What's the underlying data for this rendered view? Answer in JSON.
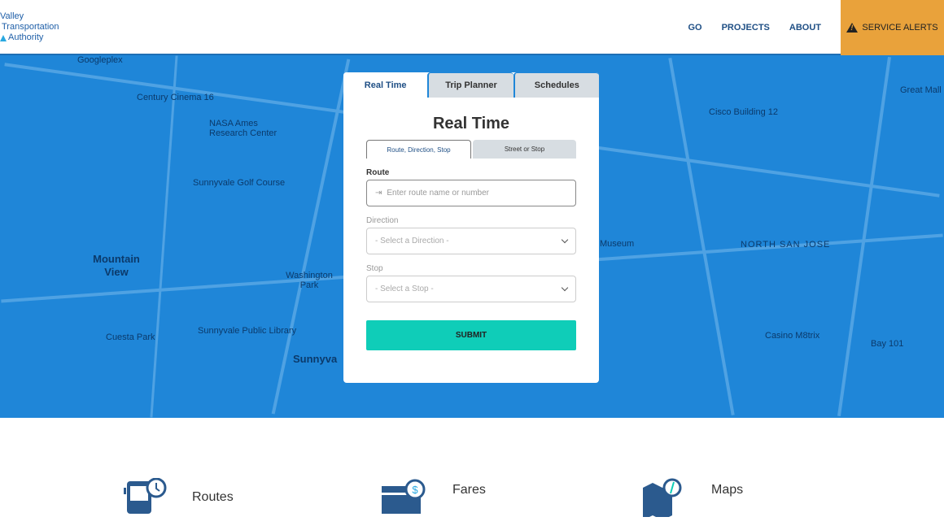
{
  "header": {
    "logo_lines": [
      "Valley",
      "Transportation",
      "Authority"
    ],
    "nav": [
      {
        "label": "GO"
      },
      {
        "label": "PROJECTS"
      },
      {
        "label": "ABOUT"
      }
    ],
    "service_alerts": "SERVICE ALERTS",
    "colors": {
      "alerts_bg": "#e9a23b",
      "brand": "#1f5fa8"
    }
  },
  "map": {
    "labels": [
      "Googleplex",
      "Century Cinema 16",
      "NASA Ames Research Center",
      "Sunnyvale Golf Course",
      "Mountain View",
      "Washington Park",
      "Cuesta Park",
      "Sunnyvale Public Library",
      "Sunnyva",
      "Cisco Building 12",
      "Great Mall",
      "NORTH SAN JOSE",
      "Museum",
      "Casino M8trix",
      "Bay 101"
    ],
    "background_color": "#1f86d8"
  },
  "panel": {
    "tabs": [
      {
        "label": "Real Time",
        "active": true
      },
      {
        "label": "Trip Planner"
      },
      {
        "label": "Schedules"
      }
    ],
    "title": "Real Time",
    "subtabs": [
      {
        "label": "Route, Direction, Stop",
        "active": true
      },
      {
        "label": "Street or Stop"
      }
    ],
    "route_label": "Route",
    "route_placeholder": "Enter route name or number",
    "direction_label": "Direction",
    "direction_value": "- Select a Direction -",
    "stop_label": "Stop",
    "stop_value": "- Select a Stop -",
    "submit": "SUBMIT",
    "submit_color": "#0fcdb8"
  },
  "features": [
    {
      "label": "Routes",
      "icon": "bus-clock-icon"
    },
    {
      "label": "Fares",
      "icon": "card-dollar-icon"
    },
    {
      "label": "Maps",
      "icon": "map-compass-icon"
    }
  ]
}
